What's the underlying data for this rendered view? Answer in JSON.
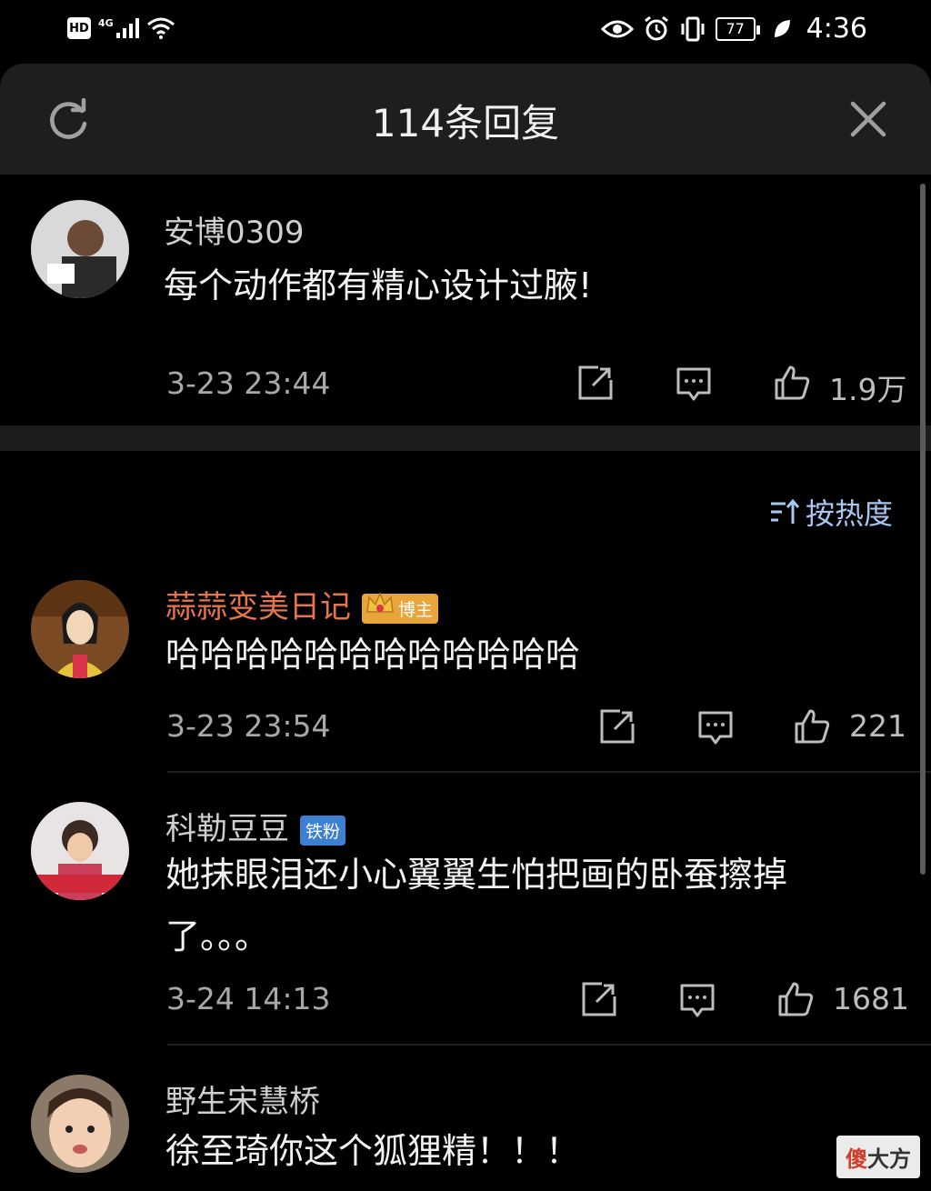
{
  "status_bar": {
    "hd": "HD",
    "network": "4G",
    "battery": "77",
    "time": "4:36"
  },
  "header": {
    "title": "114条回复"
  },
  "top_comment": {
    "username": "安博0309",
    "text": "每个动作都有精心设计过腋!",
    "time": "3-23 23:44",
    "likes": "1.9万"
  },
  "sort": {
    "label": "按热度"
  },
  "replies": [
    {
      "username": "蒜蒜变美日记",
      "badge": "博主",
      "text": "哈哈哈哈哈哈哈哈哈哈哈哈",
      "time": "3-23 23:54",
      "likes": "221"
    },
    {
      "username": "科勒豆豆",
      "badge": "铁粉",
      "text_line1": "她抹眼泪还小心翼翼生怕把画的卧蚕擦掉",
      "text_line2": "了。。。",
      "time": "3-24 14:13",
      "likes": "1681"
    },
    {
      "username": "野生宋慧桥",
      "text": "徐至琦你这个狐狸精！！！"
    }
  ],
  "watermark": {
    "first": "傻",
    "rest": "大方"
  },
  "colors": {
    "background": "#000000",
    "header": "#1e1e1e",
    "accent_blue": "#a9c6f2",
    "blogger_name": "#e8754a",
    "blogger_badge": "#e8a53b",
    "fan_badge": "#3d7fd1"
  },
  "icons": [
    "refresh-icon",
    "close-icon",
    "share-icon",
    "reply-icon",
    "like-icon",
    "sort-icon",
    "eye-icon",
    "alarm-icon",
    "vibrate-icon",
    "wifi-icon",
    "signal-icon",
    "leaf-icon"
  ]
}
